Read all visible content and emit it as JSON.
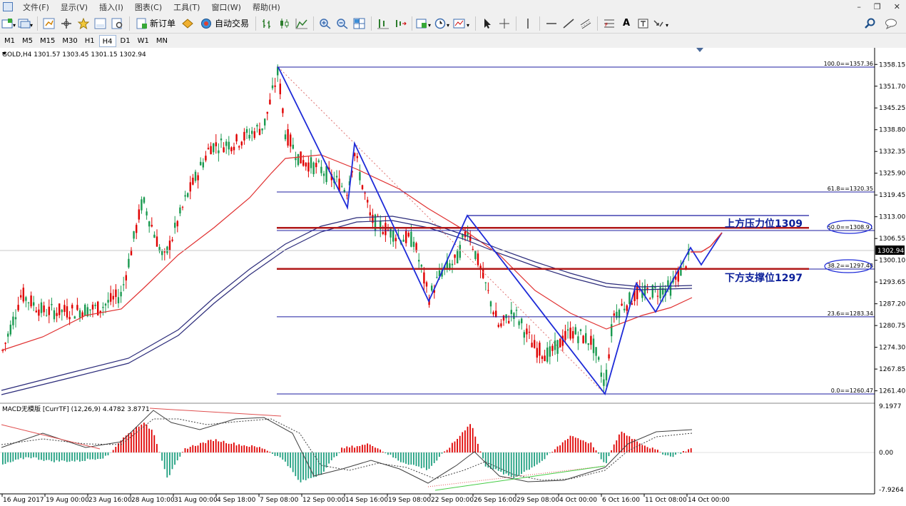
{
  "menu": [
    "文件(F)",
    "显示(V)",
    "插入(I)",
    "图表(C)",
    "工具(T)",
    "窗口(W)",
    "帮助(H)"
  ],
  "toolbar": {
    "new_order": "新订单",
    "auto_trade": "自动交易",
    "text_tool": "A"
  },
  "timeframes": [
    "M1",
    "M5",
    "M15",
    "M30",
    "H1",
    "H4",
    "D1",
    "W1",
    "MN"
  ],
  "active_timeframe": "H4",
  "chart": {
    "header": "GOLD,H4  1301.57 1303.45 1301.15 1302.94",
    "current_price": "1302.94",
    "price_ticks": [
      "1358.15",
      "1351.70",
      "1345.25",
      "1338.80",
      "1332.35",
      "1325.90",
      "1319.45",
      "1313.00",
      "1306.55",
      "1300.10",
      "1293.65",
      "1287.20",
      "1280.75",
      "1274.30",
      "1267.85",
      "1261.40"
    ],
    "fib_levels": [
      {
        "label": "100.0==1357.36",
        "price": 1357.36
      },
      {
        "label": "61.8==1320.35",
        "price": 1320.35
      },
      {
        "label": "50.0==1308.91",
        "price": 1308.91
      },
      {
        "label": "38.2==1297.48",
        "price": 1297.48
      },
      {
        "label": "23.6==1283.34",
        "price": 1283.34
      },
      {
        "label": "0.0==1260.47",
        "price": 1260.47
      }
    ],
    "annotation_resistance": "上方压力位1309",
    "annotation_support": "下方支撑位1297",
    "macd_header": "MACD无模版 [CurrTF] (12,26,9) 4.4782 3.8771",
    "macd_ticks": [
      "9.1977",
      "0.00",
      "-7.9264"
    ],
    "date_labels": [
      "16 Aug 2017",
      "19 Aug 00:00",
      "23 Aug 16:00",
      "28 Aug 10:00",
      "31 Aug 00:00",
      "4 Sep 18:00",
      "7 Sep 08:00",
      "12 Sep 00:00",
      "14 Sep 16:00",
      "19 Sep 08:00",
      "22 Sep 00:00",
      "26 Sep 16:00",
      "29 Sep 08:00",
      "4 Oct 00:00",
      "6 Oct 16:00",
      "11 Oct 08:00",
      "14 Oct 00:00"
    ]
  },
  "colors": {
    "bull": "#e00000",
    "bear": "#1a9a50",
    "fib": "#1c1ca0",
    "zigzag": "#1e2bd8",
    "ma": "#e03030",
    "slow_ma": "#2b2b7a",
    "annotation": "#0b1f9a"
  }
}
